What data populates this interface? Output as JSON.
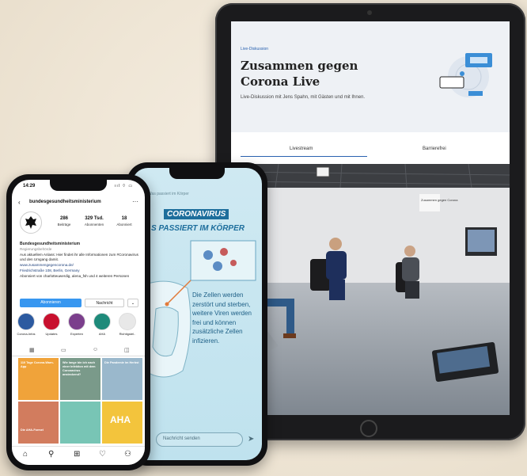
{
  "tablet": {
    "page": {
      "kicker": "Live-Diskussion",
      "title": "Zusammen gegen Corona Live",
      "subtitle": "Live-Diskussion mit Jens Spahn, mit Gästen und mit Ihnen.",
      "tabs": [
        {
          "label": "Livestream",
          "active": true
        },
        {
          "label": "Barrierefrei",
          "active": false
        }
      ],
      "studio_sign": "Zusammen gegen Corona"
    }
  },
  "phone_story": {
    "top_label": "Was passiert im Körper",
    "heading_1": "CORONAVIRUS",
    "heading_2": "S PASSIERT IM KÖRPER",
    "body": "Die Zellen werden zerstört und sterben, weitere Viren werden frei und können zusätzliche Zellen infizieren.",
    "message_placeholder": "Nachricht senden",
    "send_icon": "paper-plane-icon",
    "colors": {
      "background": "#c7e6f0",
      "accent": "#1d6e9c"
    }
  },
  "phone_instagram": {
    "status": {
      "time": "14:29",
      "icons": "ııl ⌔ ▭"
    },
    "back_glyph": "‹",
    "menu_glyph": "···",
    "username": "bundesgesundheitsministerium",
    "stats": [
      {
        "value": "286",
        "label": "Beiträge"
      },
      {
        "value": "329 Tsd.",
        "label": "Abonnenten"
      },
      {
        "value": "18",
        "label": "Abonniert"
      }
    ],
    "bio": {
      "name": "Bundesgesundheitsministerium",
      "category": "Regierungsbehörde",
      "text": "Aus aktuellem Anlass: Hier findet ihr alle Informationen zum #Coronavirus und den Umgang damit.",
      "link": "www.zusammengegencorona.de/",
      "address": "Friedrichstraße 108, Berlin, Germany",
      "followed_by": "Abonniert von charlotteuwerdig, alena_fsh und 4 weiteren Personen"
    },
    "buttons": {
      "follow": "Abonnieren",
      "message": "Nachricht",
      "more": "⌄"
    },
    "highlights": [
      {
        "label": "Corona-Infos",
        "color": "#2c5aa0"
      },
      {
        "label": "Updates",
        "color": "#c8102e"
      },
      {
        "label": "Experten",
        "color": "#7b3f8c"
      },
      {
        "label": "AHA",
        "color": "#1e8a7a"
      },
      {
        "label": "Richtigstel..",
        "color": "#e8e8e8"
      }
    ],
    "tab_icons": [
      "grid-icon",
      "reels-icon",
      "igtv-icon",
      "tagged-icon"
    ],
    "posts": [
      {
        "text": "110 Tage Corona-Warn-App",
        "color": "#f0a33a"
      },
      {
        "text": "Wie lange bin ich nach einer Infektion mit dem Coronavirus ansteckend?",
        "color": "#7a9a8a"
      },
      {
        "text": "Die Pandemie im Herbst",
        "color": "#9ab8cc"
      },
      {
        "text": "Die AHA-Formel",
        "color": "#d27c5e"
      },
      {
        "text": "",
        "color": "#78c5b5"
      },
      {
        "text": "AHA",
        "color": "#f3c43c"
      }
    ],
    "nav_icons": [
      "home-icon",
      "search-icon",
      "add-icon",
      "heart-icon",
      "profile-icon"
    ]
  }
}
